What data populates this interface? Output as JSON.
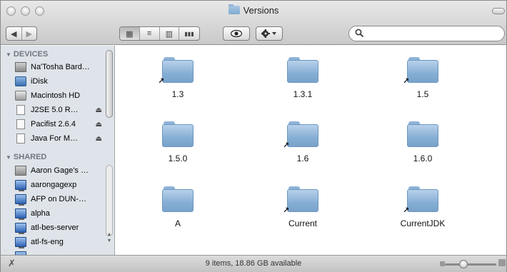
{
  "window": {
    "title": "Versions"
  },
  "toolbar": {
    "back_icon": "◀",
    "forward_icon": "▶",
    "views": [
      "icon-view-icon",
      "list-view-icon",
      "column-view-icon",
      "coverflow-view-icon"
    ],
    "view_glyphs": [
      "▦",
      "≡",
      "▥",
      "▮▮▮"
    ],
    "quicklook_glyph": "👁",
    "action_glyph": "✲▾",
    "search_placeholder": ""
  },
  "sidebar": {
    "sections": [
      {
        "title": "DEVICES",
        "items": [
          {
            "label": "Na'Tosha Bard…",
            "icon": "computer-icon",
            "eject": false
          },
          {
            "label": "iDisk",
            "icon": "idisk-icon",
            "eject": false
          },
          {
            "label": "Macintosh HD",
            "icon": "harddisk-icon",
            "eject": false
          },
          {
            "label": "J2SE 5.0 R…",
            "icon": "volume-icon",
            "eject": true
          },
          {
            "label": "Pacifist 2.6.4",
            "icon": "volume-icon",
            "eject": true
          },
          {
            "label": "Java For M…",
            "icon": "volume-icon",
            "eject": true
          }
        ]
      },
      {
        "title": "SHARED",
        "items": [
          {
            "label": "Aaron Gage's …",
            "icon": "computer-icon",
            "eject": false
          },
          {
            "label": "aarongagexp",
            "icon": "network-computer-icon",
            "eject": false
          },
          {
            "label": "AFP on DUN-…",
            "icon": "network-computer-icon",
            "eject": false
          },
          {
            "label": "alpha",
            "icon": "network-computer-icon",
            "eject": false
          },
          {
            "label": "atl-bes-server",
            "icon": "network-computer-icon",
            "eject": false
          },
          {
            "label": "atl-fs-eng",
            "icon": "network-computer-icon",
            "eject": false
          }
        ]
      }
    ],
    "eject_glyph": "⏏"
  },
  "content": {
    "items": [
      {
        "name": "1.3",
        "alias": true
      },
      {
        "name": "1.3.1",
        "alias": false
      },
      {
        "name": "1.5",
        "alias": true
      },
      {
        "name": "1.5.0",
        "alias": false
      },
      {
        "name": "1.6",
        "alias": true
      },
      {
        "name": "1.6.0",
        "alias": false
      },
      {
        "name": "A",
        "alias": false
      },
      {
        "name": "Current",
        "alias": true
      },
      {
        "name": "CurrentJDK",
        "alias": true
      }
    ],
    "alias_glyph": "↗"
  },
  "statusbar": {
    "text": "9 items, 18.86 GB available",
    "noedit_glyph": "✗"
  },
  "colors": {
    "sidebar_bg": "#dfe4ea",
    "folder_blue": "#86aed4"
  }
}
